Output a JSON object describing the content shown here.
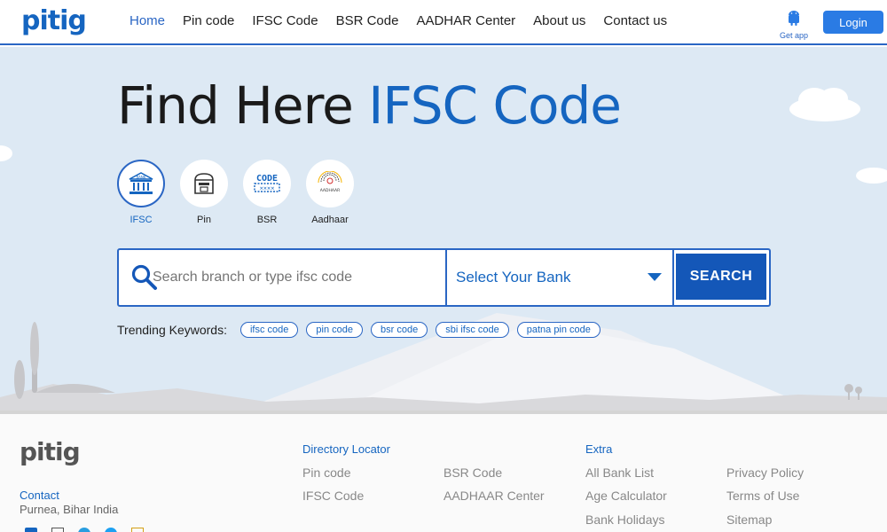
{
  "header": {
    "logo": "pitig",
    "nav": [
      "Home",
      "Pin code",
      "IFSC Code",
      "BSR Code",
      "AADHAR Center",
      "About us",
      "Contact us"
    ],
    "active_nav": "Home",
    "get_app_label": "Get app",
    "login_label": "Login"
  },
  "hero": {
    "title_plain": "Find Here",
    "title_accent": "IFSC Code",
    "categories": [
      {
        "label": "IFSC",
        "icon": "bank-icon",
        "badge": "BANK",
        "active": true
      },
      {
        "label": "Pin",
        "icon": "mailbox-icon",
        "active": false
      },
      {
        "label": "BSR",
        "icon": "code-icon",
        "badge": "CODE",
        "active": false
      },
      {
        "label": "Aadhaar",
        "icon": "aadhaar-icon",
        "badge": "AADHAAR",
        "active": false
      }
    ],
    "search": {
      "placeholder": "Search branch or type ifsc code",
      "select_value": "Select Your Bank",
      "button_label": "SEARCH"
    },
    "trending_label": "Trending Keywords:",
    "trending": [
      "ifsc code",
      "pin code",
      "bsr code",
      "sbi ifsc code",
      "patna pin code"
    ]
  },
  "footer": {
    "logo": "pitig",
    "contact_label": "Contact",
    "address": "Purnea, Bihar India",
    "directory_heading": "Directory Locator",
    "directory_links": [
      "Pin code",
      "BSR Code",
      "IFSC Code",
      "AADHAAR Center"
    ],
    "extra_heading": "Extra",
    "extra_links": [
      "All Bank List",
      "Privacy Policy",
      "Age Calculator",
      "Terms of Use",
      "Bank Holidays",
      "Sitemap"
    ],
    "social_icons": [
      "facebook-icon",
      "mail-icon",
      "telegram-icon",
      "twitter-icon",
      "email-icon"
    ]
  },
  "colors": {
    "brand": "#1565c0",
    "accent_border": "#2a66c4",
    "button": "#1457b8",
    "login": "#2a7be4",
    "hero_bg": "#dde9f4"
  }
}
